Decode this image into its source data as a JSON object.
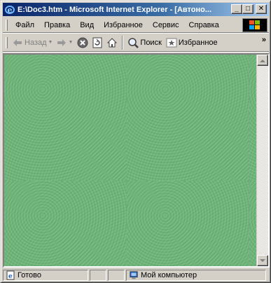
{
  "window": {
    "title": "E:\\Doc3.htm - Microsoft Internet Explorer - [Автоно...",
    "controls": {
      "minimize": "_",
      "maximize": "□",
      "close": "✕"
    }
  },
  "menu": [
    "Файл",
    "Правка",
    "Вид",
    "Избранное",
    "Сервис",
    "Справка"
  ],
  "toolbar": {
    "back_label": "Назад",
    "search_label": "Поиск",
    "favorites_label": "Избранное",
    "more": "»"
  },
  "content": {
    "background_color": "#b4dcbc",
    "pattern": "concentric-rings"
  },
  "statusbar": {
    "status_text": "Готово",
    "zone_text": "Мой компьютер"
  },
  "icons": [
    "ie-icon",
    "windows-logo-icon",
    "back-arrow-icon",
    "forward-arrow-icon",
    "stop-icon",
    "refresh-icon",
    "home-icon",
    "search-icon",
    "favorites-icon",
    "page-icon",
    "computer-icon"
  ],
  "colors": {
    "titlebar_start": "#0a246a",
    "titlebar_end": "#a6caf0",
    "chrome": "#d4d0c8"
  }
}
